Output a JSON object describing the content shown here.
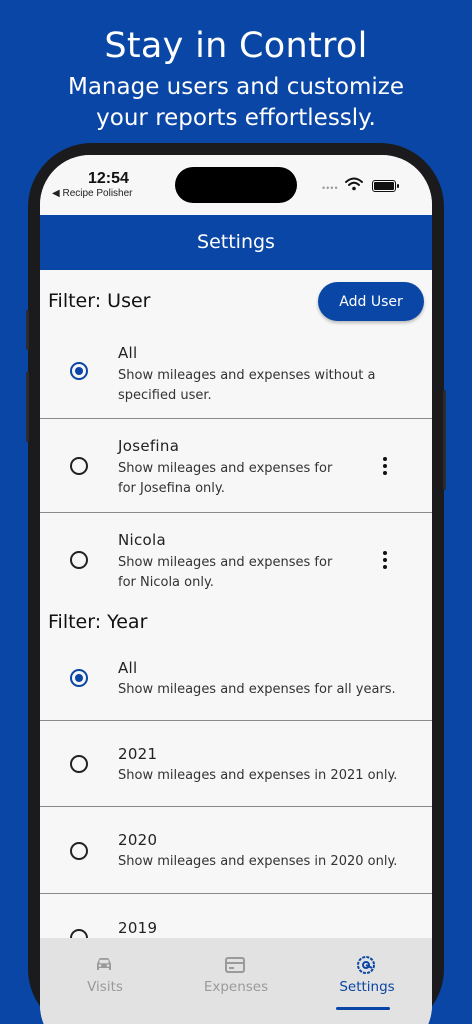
{
  "promo": {
    "title": "Stay in Control",
    "subtitle_line1": "Manage users and customize",
    "subtitle_line2": "your reports effortlessly."
  },
  "status_bar": {
    "time": "12:54",
    "back_app": "◀ Recipe Polisher"
  },
  "appbar": {
    "title": "Settings"
  },
  "user_filter": {
    "title": "Filter: User",
    "add_button": "Add User",
    "items": [
      {
        "title": "All",
        "desc_line1": "Show mileages and expenses without a",
        "desc_line2": "specified user.",
        "selected": true
      },
      {
        "title": "Josefina",
        "desc_line1": "Show mileages and expenses for",
        "desc_line2": "for Josefina only.",
        "selected": false
      },
      {
        "title": "Nicola",
        "desc_line1": "Show mileages and expenses for",
        "desc_line2": "for Nicola only.",
        "selected": false
      }
    ]
  },
  "year_filter": {
    "title": "Filter: Year",
    "items": [
      {
        "title": "All",
        "desc": "Show mileages and expenses for all years.",
        "selected": true
      },
      {
        "title": "2021",
        "desc": "Show mileages and expenses in 2021 only.",
        "selected": false
      },
      {
        "title": "2020",
        "desc": "Show mileages and expenses in 2020 only.",
        "selected": false
      },
      {
        "title": "2019",
        "desc": "",
        "selected": false
      }
    ]
  },
  "bottom_nav": {
    "items": [
      {
        "label": "Visits",
        "icon": "car-icon",
        "active": false
      },
      {
        "label": "Expenses",
        "icon": "card-icon",
        "active": false
      },
      {
        "label": "Settings",
        "icon": "settings-icon",
        "active": true
      }
    ]
  },
  "colors": {
    "brand": "#0a46a5",
    "inactive": "#9a9a9a",
    "nav_bg": "#e2e2e2"
  }
}
